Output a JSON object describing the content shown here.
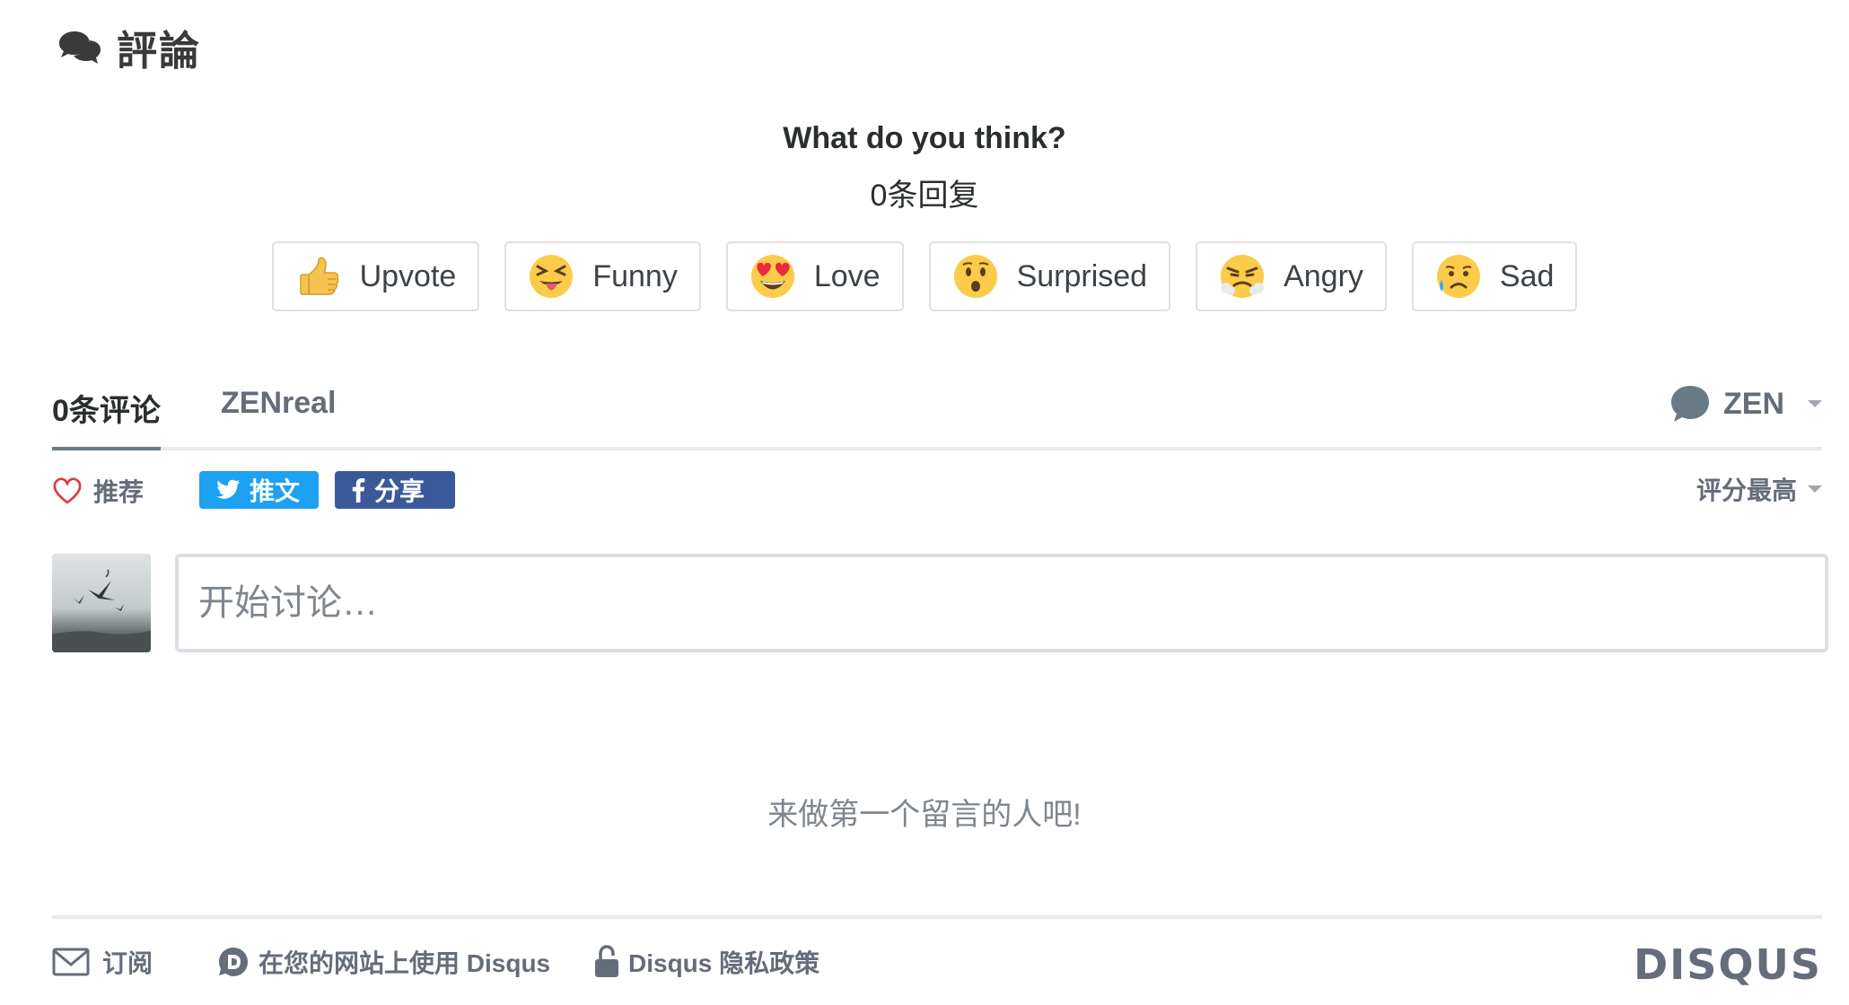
{
  "header": {
    "title": "評論",
    "icon": "chat-bubbles-icon"
  },
  "reactions": {
    "question": "What do you think?",
    "replies": "0条回复",
    "items": [
      {
        "label": "Upvote",
        "icon": "thumbs-up-emoji"
      },
      {
        "label": "Funny",
        "icon": "squinting-tongue-emoji"
      },
      {
        "label": "Love",
        "icon": "heart-eyes-emoji"
      },
      {
        "label": "Surprised",
        "icon": "hushed-face-emoji"
      },
      {
        "label": "Angry",
        "icon": "steaming-angry-emoji"
      },
      {
        "label": "Sad",
        "icon": "sad-sweat-emoji"
      }
    ]
  },
  "tabs": {
    "comments": "0条评论",
    "site": "ZENreal"
  },
  "user": {
    "name": "ZEN"
  },
  "actions": {
    "recommend": "推荐",
    "tweet": "推文",
    "share": "分享",
    "sort": "评分最高"
  },
  "composer": {
    "placeholder": "开始讨论…"
  },
  "empty": "来做第一个留言的人吧!",
  "footer": {
    "subscribe": "订阅",
    "add_disqus": "在您的网站上使用 Disqus",
    "privacy": "Disqus 隐私政策",
    "logo": "DISQUS"
  },
  "colors": {
    "twitter": "#1da1f2",
    "facebook": "#3b5998",
    "muted": "#656c7a",
    "heart": "#e0393e"
  }
}
